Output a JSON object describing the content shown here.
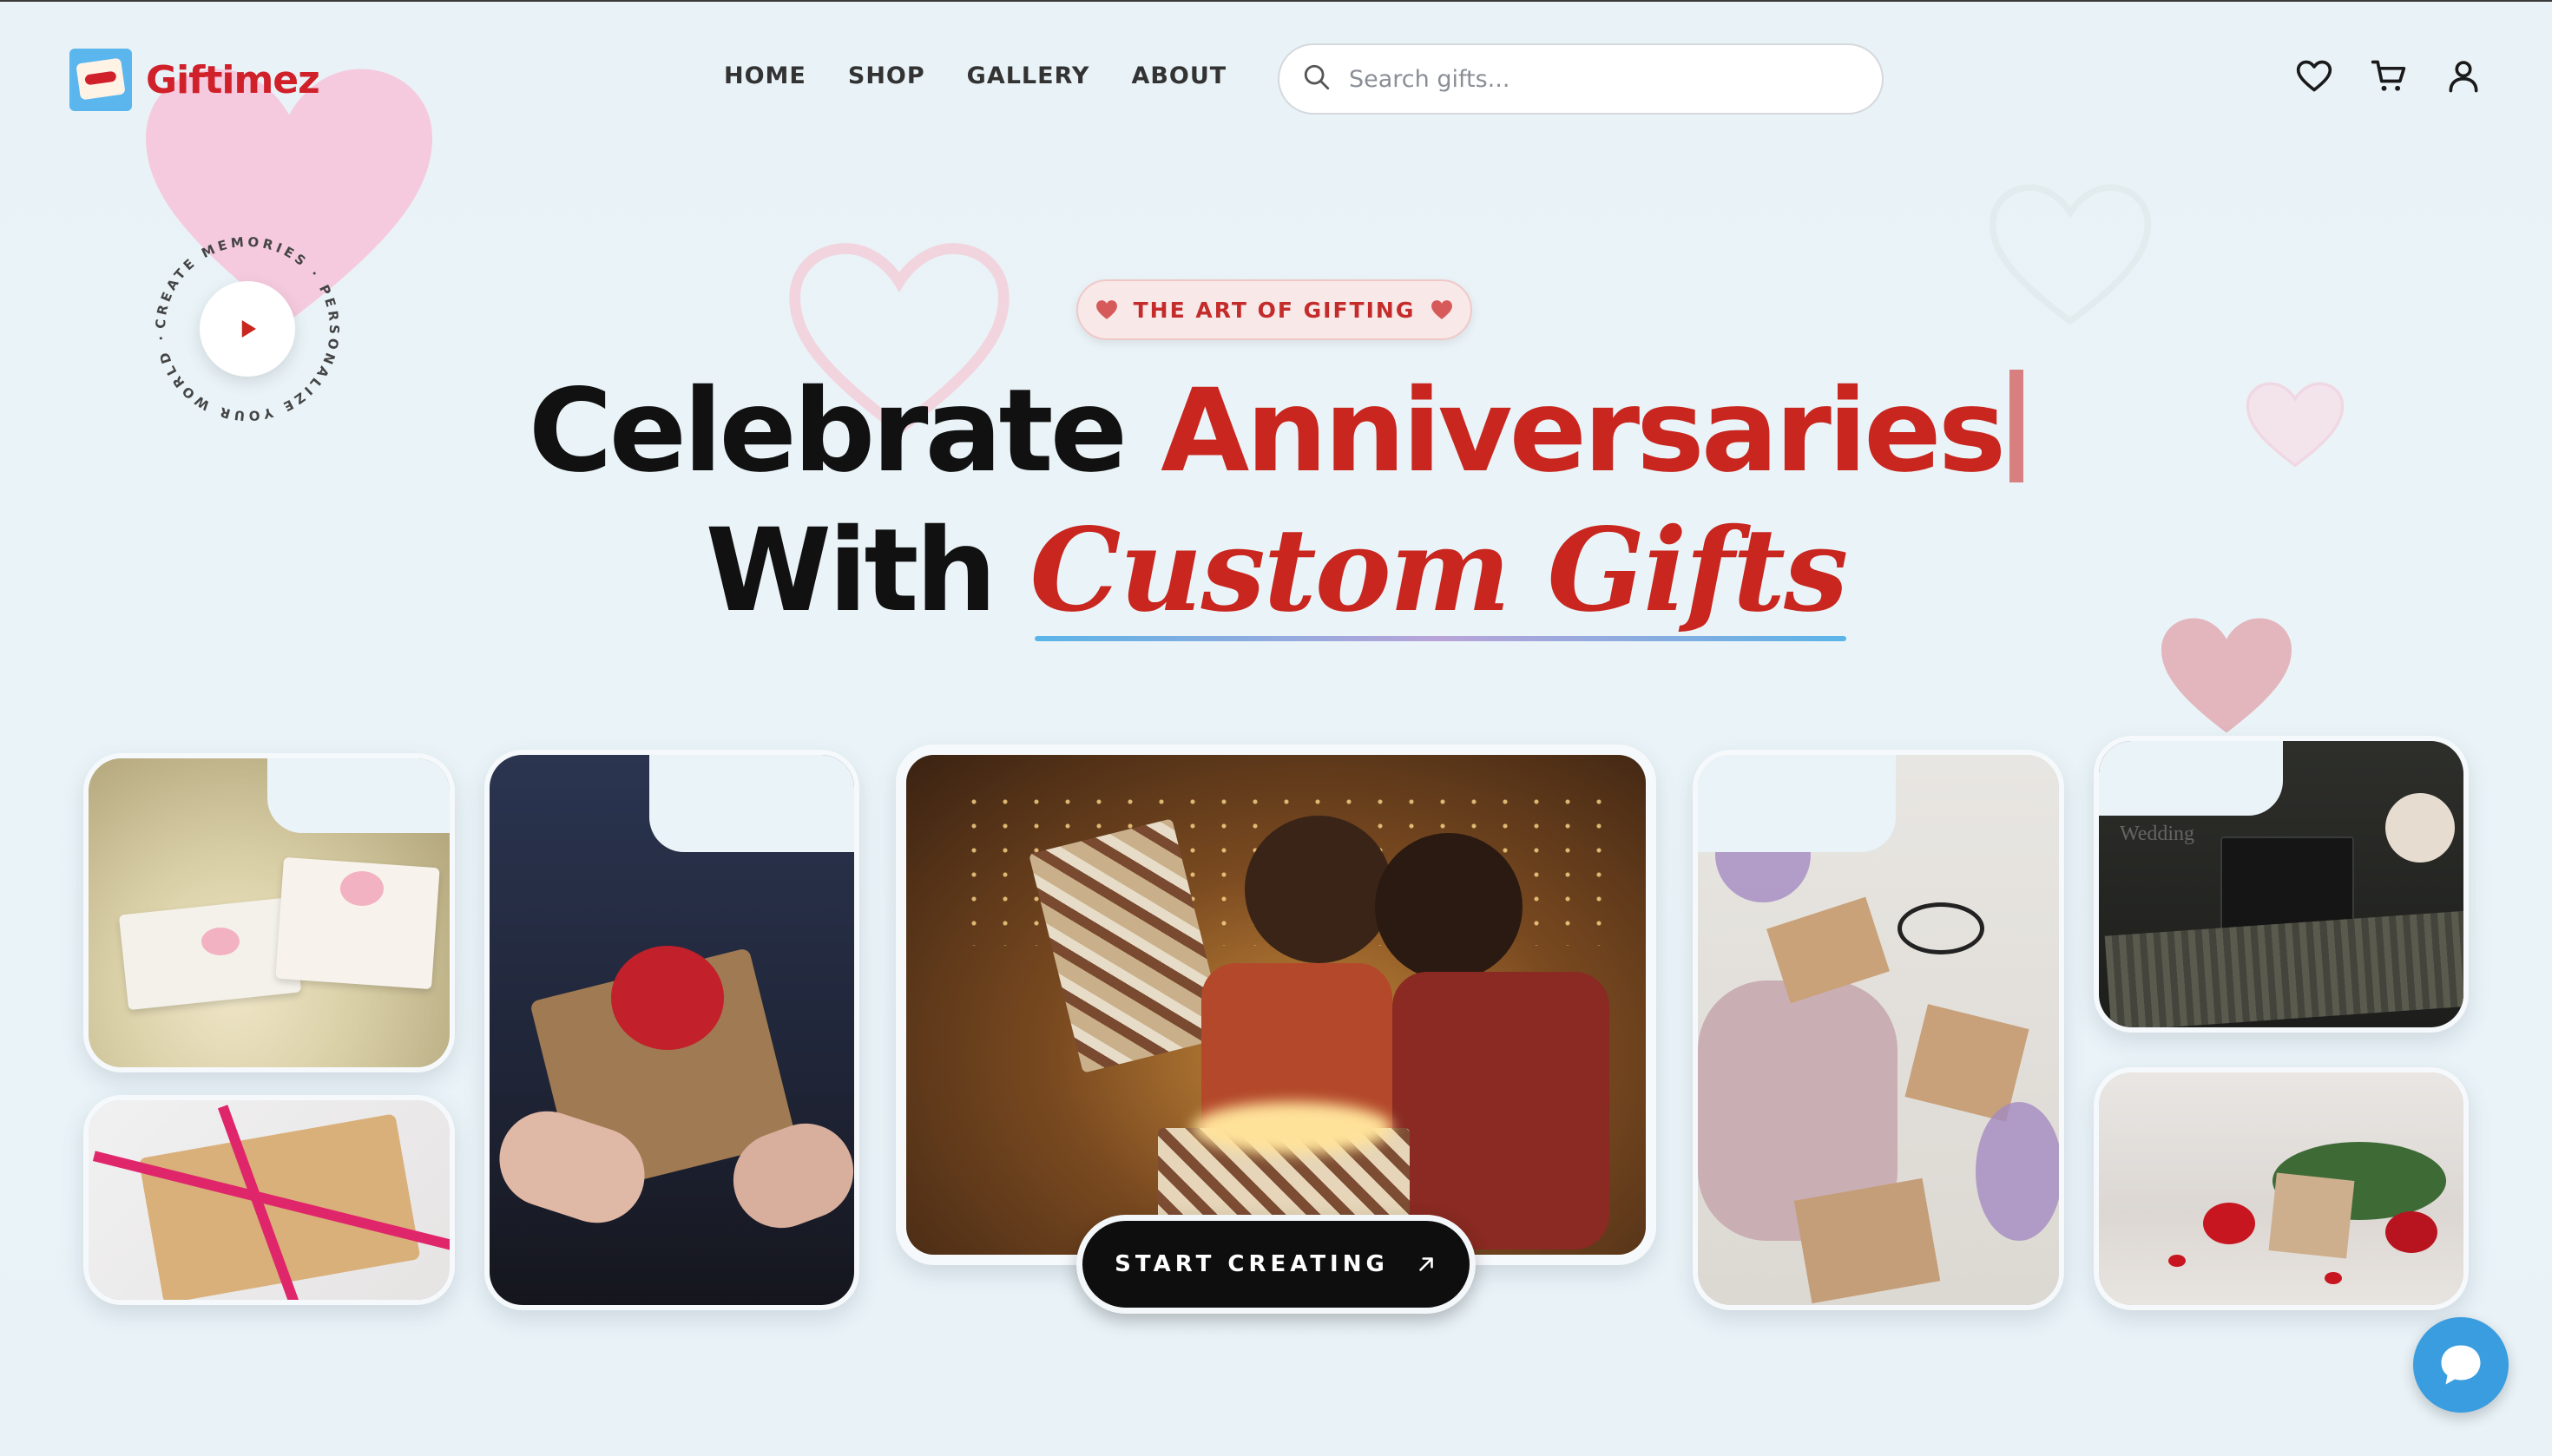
{
  "brand": {
    "name": "Giftimez",
    "accent": "#d0202a"
  },
  "nav": {
    "items": [
      "HOME",
      "SHOP",
      "GALLERY",
      "ABOUT"
    ]
  },
  "search": {
    "placeholder": "Search gifts...",
    "value": ""
  },
  "header_icons": [
    "heart-icon",
    "cart-icon",
    "user-icon"
  ],
  "play_badge": {
    "ring_text": "CREATE MEMORIES · PERSONALIZE YOUR WORLD · "
  },
  "hero": {
    "eyebrow": "THE ART OF GIFTING",
    "line1_prefix": "Celebrate",
    "line1_highlight": "Anniversaries",
    "line2_prefix": "With",
    "line2_highlight": "Custom Gifts"
  },
  "gallery": {
    "images": [
      "wrapped gifts with pink roses",
      "kraft gift with pink ribbon",
      "hands holding gift with red bow",
      "couple opening gift box",
      "kraft envelopes with lavender",
      "black gift boxes with twine",
      "gift box with red roses"
    ],
    "overlay_text": "Wedding"
  },
  "cta": {
    "label": "START CREATING"
  },
  "chat": {
    "icon": "chat-icon"
  },
  "colors": {
    "red": "#c8261f",
    "pill_bg": "#f8e8e8",
    "chat": "#3a9de0",
    "background": "#eaf4f8"
  }
}
